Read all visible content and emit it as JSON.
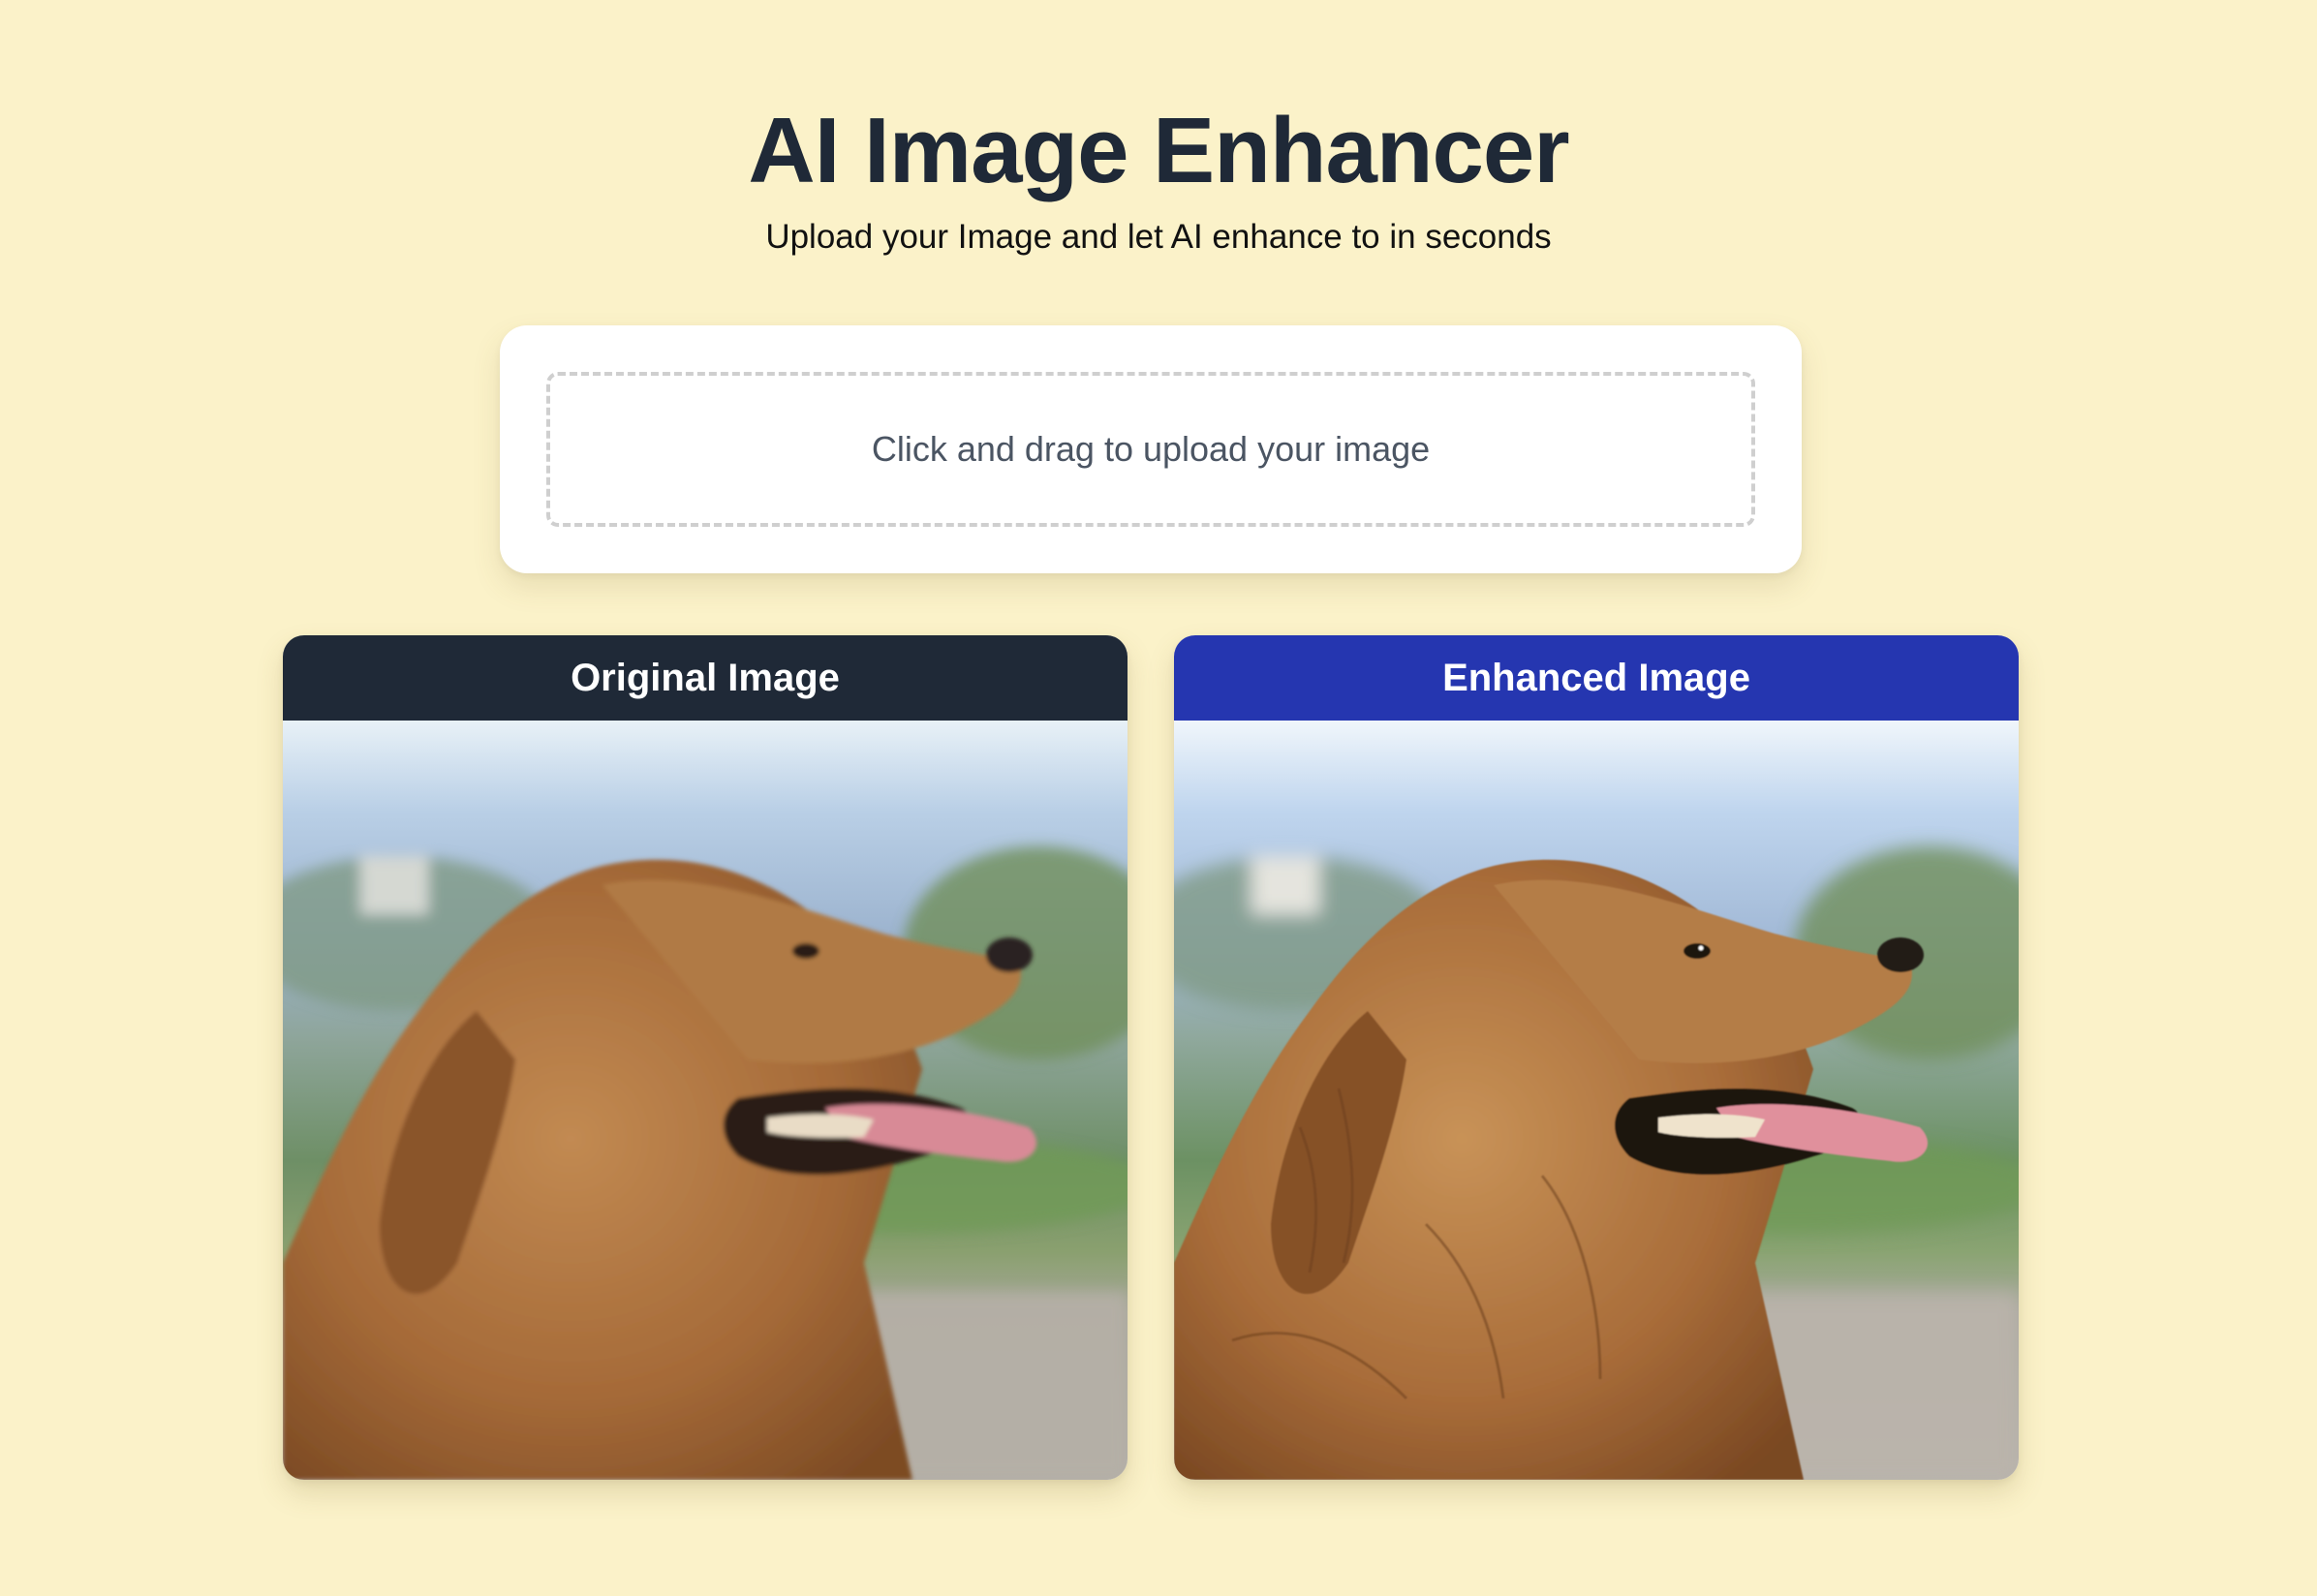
{
  "header": {
    "title": "AI Image Enhancer",
    "subtitle": "Upload your Image and let AI enhance to in seconds"
  },
  "upload": {
    "label": "Click and drag to upload your image"
  },
  "panels": {
    "original": {
      "title": "Original Image",
      "header_color": "#1f2937"
    },
    "enhanced": {
      "title": "Enhanced Image",
      "header_color": "#2536b0"
    }
  },
  "colors": {
    "background": "#fbf2c9",
    "card": "#ffffff",
    "text_dark": "#1f2937"
  },
  "images": {
    "original": "golden retriever profile photo (blurry)",
    "enhanced": "golden retriever profile photo (sharpened)"
  }
}
